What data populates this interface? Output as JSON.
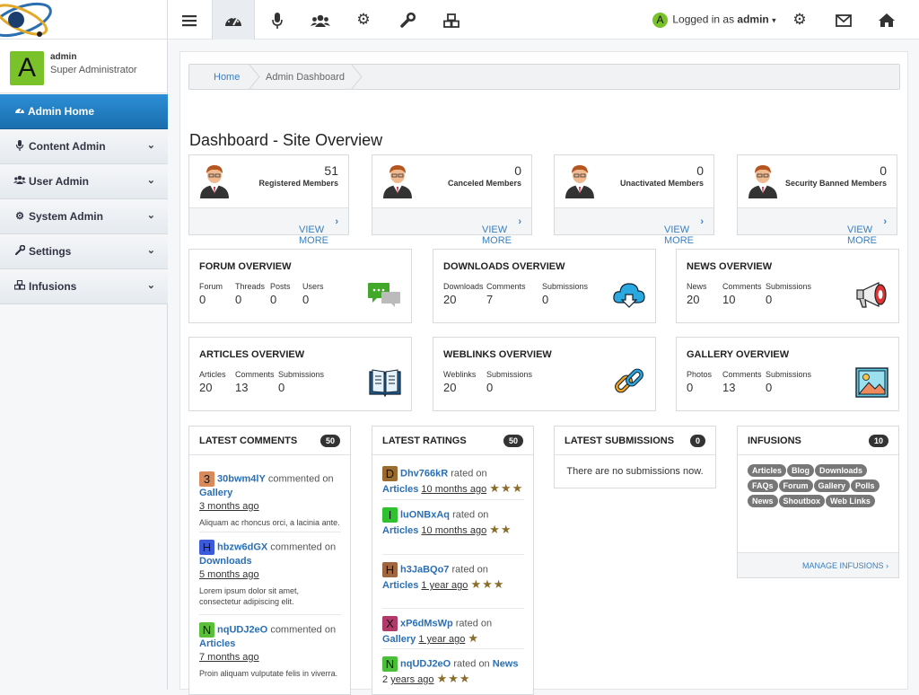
{
  "app": {
    "title": "Admin Dashboard"
  },
  "sidebar": {
    "profile": {
      "initial": "A",
      "username": "admin",
      "role": "Super Administrator"
    },
    "items": [
      {
        "label": "Admin Home",
        "icon": "dashboard-icon"
      },
      {
        "label": "Content Admin",
        "icon": "microphone-icon"
      },
      {
        "label": "User Admin",
        "icon": "users-icon"
      },
      {
        "label": "System Admin",
        "icon": "gear-icon"
      },
      {
        "label": "Settings",
        "icon": "wrench-icon"
      },
      {
        "label": "Infusions",
        "icon": "cubes-icon"
      }
    ]
  },
  "topbar": {
    "icons": [
      "menu-icon",
      "dashboard-icon",
      "microphone-icon",
      "users-icon",
      "gear-icon",
      "wrench-icon",
      "cubes-icon"
    ],
    "user_initial": "A",
    "logged_in_prefix": "Logged in as",
    "logged_in_user": "admin",
    "right_icons": [
      "gear-icon",
      "envelope-icon",
      "home-icon"
    ]
  },
  "breadcrumb": {
    "home": "Home",
    "current": "Admin Dashboard"
  },
  "page_title": "Dashboard - Site Overview",
  "members": [
    {
      "count": "51",
      "label": "Registered Members",
      "link": "VIEW MORE"
    },
    {
      "count": "0",
      "label": "Canceled Members",
      "link": "VIEW MORE"
    },
    {
      "count": "0",
      "label": "Unactivated Members",
      "link": "VIEW MORE"
    },
    {
      "count": "0",
      "label": "Security Banned Members",
      "link": "VIEW MORE"
    }
  ],
  "overviews": [
    {
      "title": "FORUM OVERVIEW",
      "stats": [
        {
          "label": "Forum",
          "value": "0"
        },
        {
          "label": "Threads",
          "value": "0"
        },
        {
          "label": "Posts",
          "value": "0"
        },
        {
          "label": "Users",
          "value": "0"
        }
      ],
      "icon": "chat-icon"
    },
    {
      "title": "DOWNLOADS OVERVIEW",
      "stats": [
        {
          "label": "Downloads",
          "value": "20"
        },
        {
          "label": "Comments",
          "value": "7"
        },
        {
          "label": "Submissions",
          "value": "0"
        }
      ],
      "icon": "cloud-download-icon"
    },
    {
      "title": "NEWS OVERVIEW",
      "stats": [
        {
          "label": "News",
          "value": "20"
        },
        {
          "label": "Comments",
          "value": "10"
        },
        {
          "label": "Submissions",
          "value": "0"
        }
      ],
      "icon": "megaphone-icon"
    },
    {
      "title": "ARTICLES OVERVIEW",
      "stats": [
        {
          "label": "Articles",
          "value": "20"
        },
        {
          "label": "Comments",
          "value": "13"
        },
        {
          "label": "Submissions",
          "value": "0"
        }
      ],
      "icon": "book-icon"
    },
    {
      "title": "WEBLINKS OVERVIEW",
      "stats": [
        {
          "label": "Weblinks",
          "value": "20"
        },
        {
          "label": "Submissions",
          "value": "0"
        }
      ],
      "icon": "chain-link-icon"
    },
    {
      "title": "GALLERY OVERVIEW",
      "stats": [
        {
          "label": "Photos",
          "value": "0"
        },
        {
          "label": "Comments",
          "value": "13"
        },
        {
          "label": "Submissions",
          "value": "0"
        }
      ],
      "icon": "picture-icon"
    }
  ],
  "latest_comments": {
    "title": "LATEST COMMENTS",
    "badge": "50",
    "items": [
      {
        "initial": "3",
        "color": "#d98a5b",
        "user": "30bwm4lY",
        "action": "commented on",
        "target": "Gallery",
        "time": "3 months ago",
        "excerpt": "Aliquam ac rhoncus orci, a lacinia ante."
      },
      {
        "initial": "H",
        "color": "#3b5bdb",
        "user": "hbzw6dGX",
        "action": "commented on",
        "target": "Downloads",
        "time": "5 months ago",
        "excerpt": "Lorem ipsum dolor sit amet, consectetur adipiscing elit."
      },
      {
        "initial": "N",
        "color": "#5bbf3a",
        "user": "nqUDJ2eO",
        "action": "commented on",
        "target": "Articles",
        "time": "7 months ago",
        "excerpt": "Proin aliquam vulputate felis in viverra."
      }
    ]
  },
  "latest_ratings": {
    "title": "LATEST RATINGS",
    "badge": "50",
    "items": [
      {
        "initial": "D",
        "color": "#9a6a2f",
        "user": "Dhv766kR",
        "action": "rated on",
        "target": "Articles",
        "time": "10 months ago",
        "stars": "★★★"
      },
      {
        "initial": "I",
        "color": "#2fc12f",
        "user": "luONBxAq",
        "action": "rated on",
        "target": "Articles",
        "time": "10 months ago",
        "stars": "★★"
      },
      {
        "initial": "H",
        "color": "#a0663f",
        "user": "h3JaBQo7",
        "action": "rated on",
        "target": "Articles",
        "time": "1 year ago",
        "stars": "★★★"
      },
      {
        "initial": "X",
        "color": "#b23a6a",
        "user": "xP6dMsWp",
        "action": "rated on",
        "target": "Gallery",
        "time": "1 year ago",
        "stars": "★"
      },
      {
        "initial": "N",
        "color": "#4cbf3a",
        "user": "nqUDJ2eO",
        "action": "rated on",
        "target": "News",
        "target_suffix": "2",
        "time": "years ago",
        "stars": "★★★"
      }
    ]
  },
  "latest_submissions": {
    "title": "LATEST SUBMISSIONS",
    "badge": "0",
    "empty": "There are no submissions now."
  },
  "infusions": {
    "title": "INFUSIONS",
    "badge": "10",
    "tags": [
      "Articles",
      "Blog",
      "Downloads",
      "FAQs",
      "Forum",
      "Gallery",
      "Polls",
      "News",
      "Shoutbox",
      "Web Links"
    ],
    "manage": "MANAGE INFUSIONS"
  }
}
